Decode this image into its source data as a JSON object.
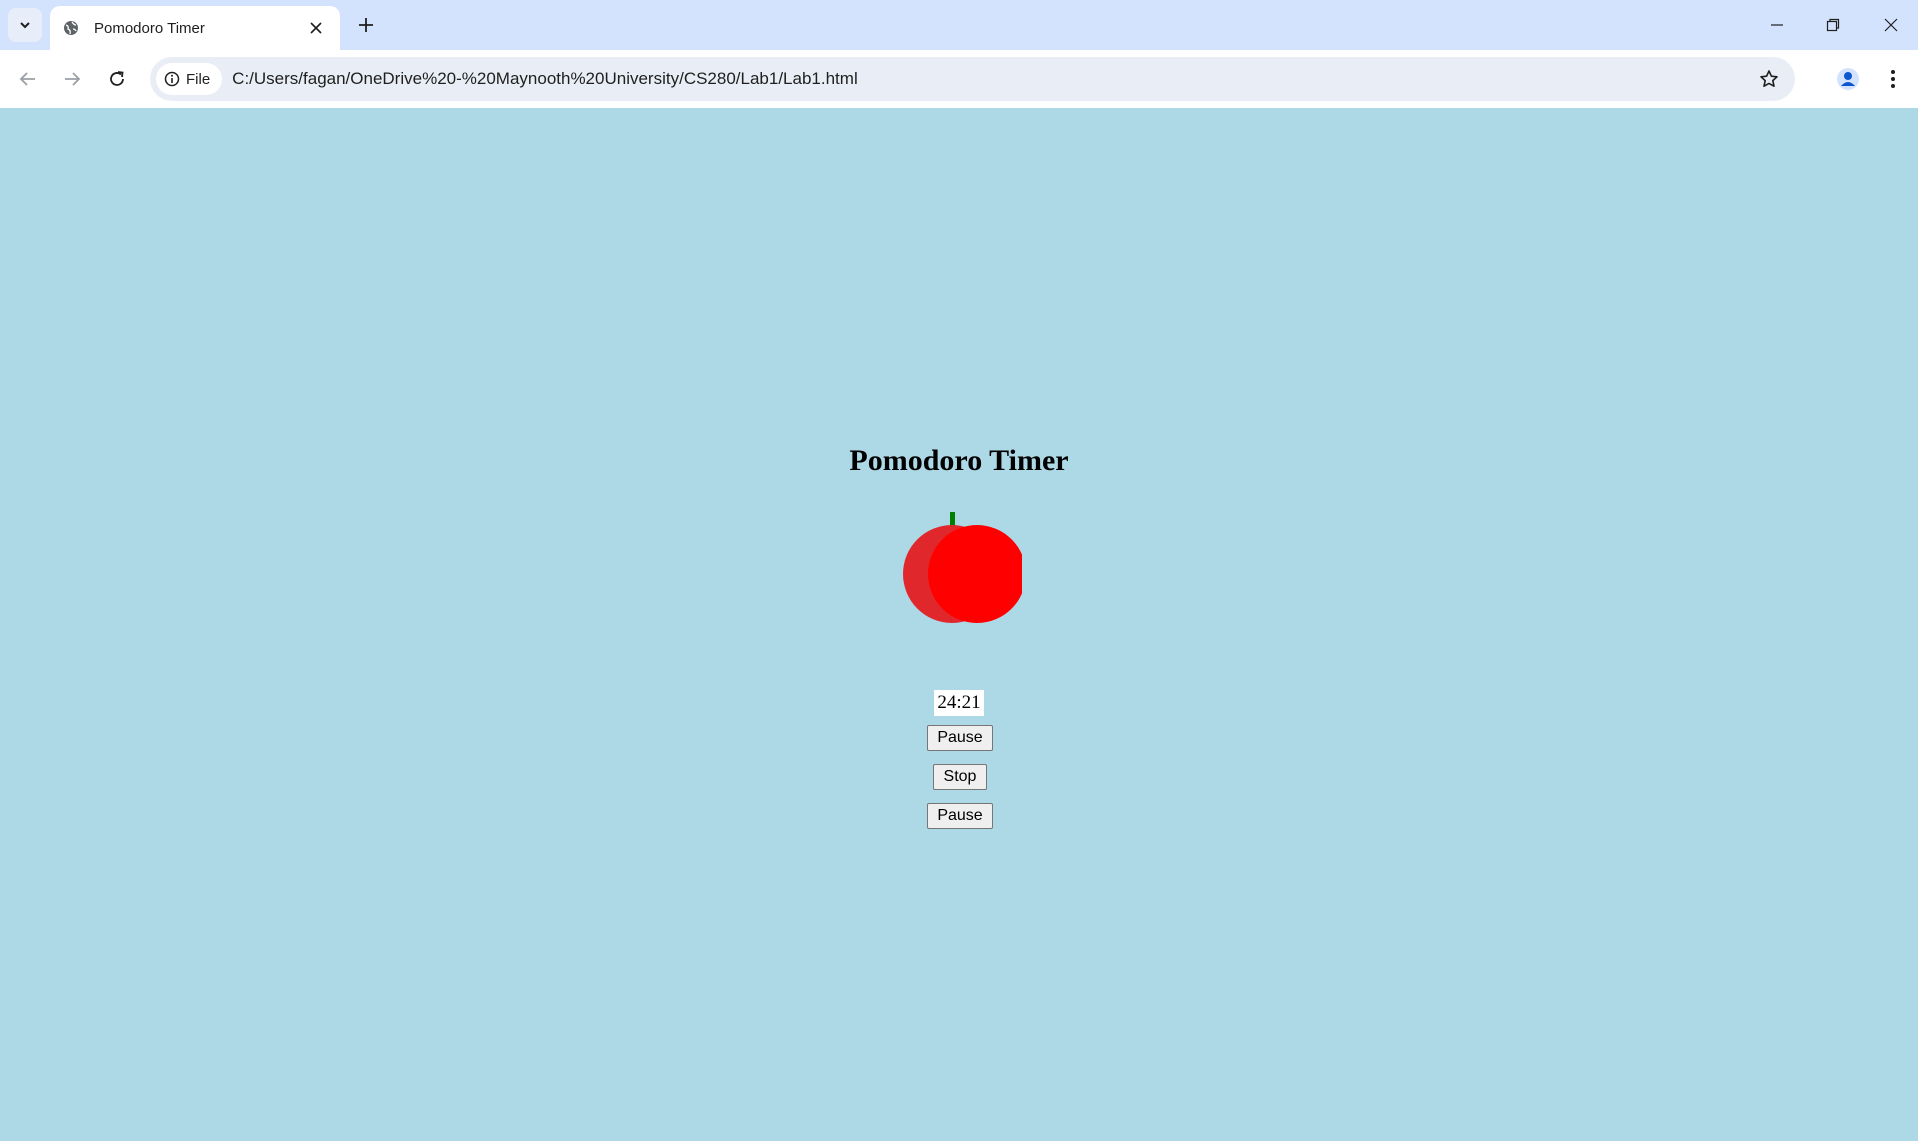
{
  "browser": {
    "tab": {
      "title": "Pomodoro Timer"
    },
    "address_bar": {
      "chip_label": "File",
      "url": "C:/Users/fagan/OneDrive%20-%20Maynooth%20University/CS280/Lab1/Lab1.html"
    },
    "icons": {
      "tab_search": "chevron-down-icon",
      "favicon": "globe-icon",
      "tab_close": "close-icon",
      "new_tab": "plus-icon",
      "minimize": "minimize-icon",
      "restore": "restore-icon",
      "close_window": "close-icon",
      "back": "arrow-left-icon",
      "forward": "arrow-right-icon",
      "reload": "reload-icon",
      "site_info": "info-icon",
      "bookmark": "star-icon",
      "profile": "person-icon",
      "menu": "kebab-menu-icon"
    }
  },
  "page": {
    "background": "#add8e6",
    "title": "Pomodoro Timer",
    "tomato": {
      "body_color": "#ff0000",
      "shadow_color": "#e0282c",
      "stem_color": "#008000"
    },
    "timer": "24:21",
    "buttons": {
      "pause_1": "Pause",
      "stop": "Stop",
      "pause_2": "Pause"
    }
  }
}
